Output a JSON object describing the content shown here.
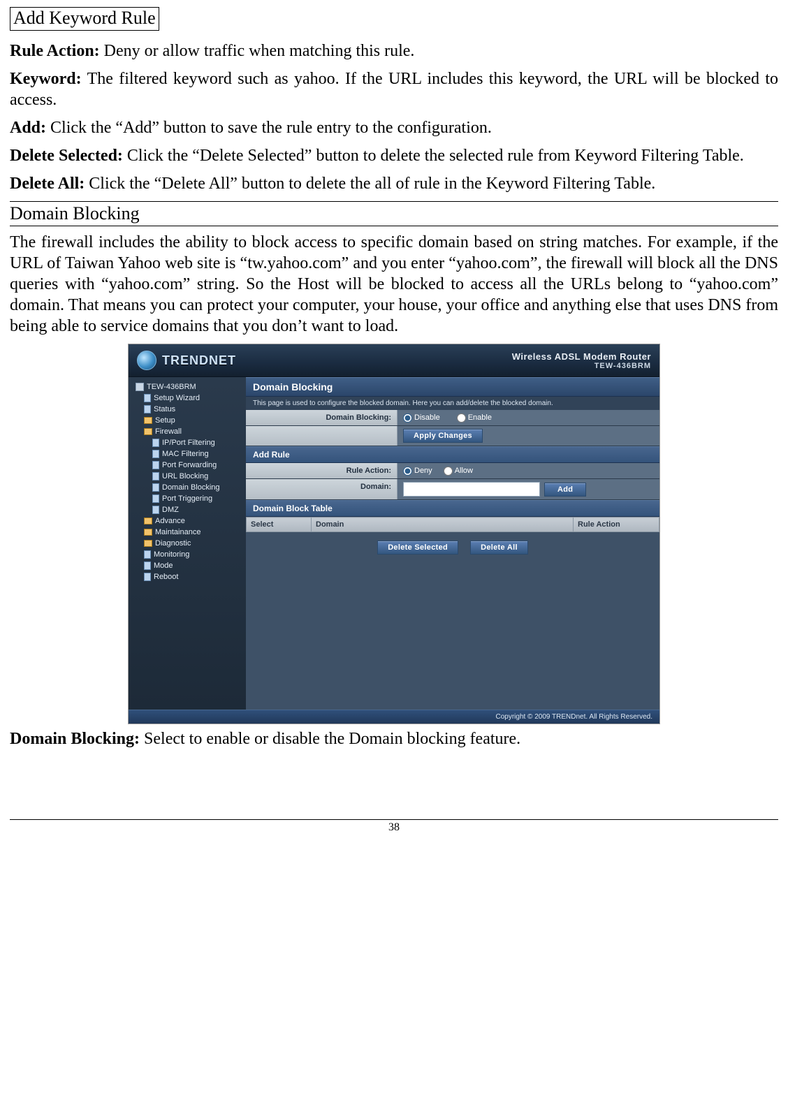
{
  "keyword_rule": {
    "box_title": "Add Keyword Rule",
    "rule_action_label": "Rule Action:",
    "rule_action_text": " Deny or allow traffic when matching this rule.",
    "keyword_label": "Keyword:",
    "keyword_text": " The filtered keyword such as yahoo. If the URL includes this keyword, the URL will be blocked to access.",
    "add_label": "Add:",
    "add_text": " Click the “Add” button to save the rule entry to the configuration.",
    "delsel_label": "Delete Selected:",
    "delsel_text": " Click the “Delete Selected” button to delete the selected rule from Keyword Filtering Table.",
    "delall_label": "Delete All:",
    "delall_text": " Click the “Delete All” button to delete the all of rule in the Keyword Filtering Table."
  },
  "domain_blocking": {
    "section_title": "Domain Blocking",
    "intro": "The firewall includes the ability to block access to specific domain based on string matches. For example, if the URL of Taiwan Yahoo web site is “tw.yahoo.com” and you enter “yahoo.com”, the firewall will block all the DNS queries with “yahoo.com” string. So the Host will be blocked to access all the URLs belong to “yahoo.com” domain. That means you can protect your computer, your house, your office and anything else that uses DNS from being able to service domains that you don’t want to load.",
    "after_label": "Domain Blocking:",
    "after_text": " Select to enable or disable the Domain blocking feature."
  },
  "router": {
    "brand": "TRENDNET",
    "model_line1": "Wireless ADSL Modem Router",
    "model_line2": "TEW-436BRM",
    "nav": {
      "root": "TEW-436BRM",
      "items": [
        "Setup Wizard",
        "Status",
        "Setup",
        "Firewall"
      ],
      "firewall_children": [
        "IP/Port Filtering",
        "MAC Filtering",
        "Port Forwarding",
        "URL Blocking",
        "Domain Blocking",
        "Port Triggering",
        "DMZ"
      ],
      "after": [
        "Advance",
        "Maintainance",
        "Diagnostic",
        "Monitoring",
        "Mode",
        "Reboot"
      ]
    },
    "panel": {
      "title": "Domain Blocking",
      "desc": "This page is used to configure the blocked domain. Here you can add/delete the blocked domain.",
      "domain_blocking_label": "Domain Blocking:",
      "disable": "Disable",
      "enable": "Enable",
      "apply": "Apply Changes",
      "add_rule": "Add Rule",
      "rule_action_label": "Rule Action:",
      "deny": "Deny",
      "allow": "Allow",
      "domain_label": "Domain:",
      "add_btn": "Add",
      "table_title": "Domain Block Table",
      "th_select": "Select",
      "th_domain": "Domain",
      "th_action": "Rule Action",
      "delete_selected": "Delete Selected",
      "delete_all": "Delete All"
    },
    "footer": "Copyright © 2009 TRENDnet. All Rights Reserved."
  },
  "page_number": "38"
}
